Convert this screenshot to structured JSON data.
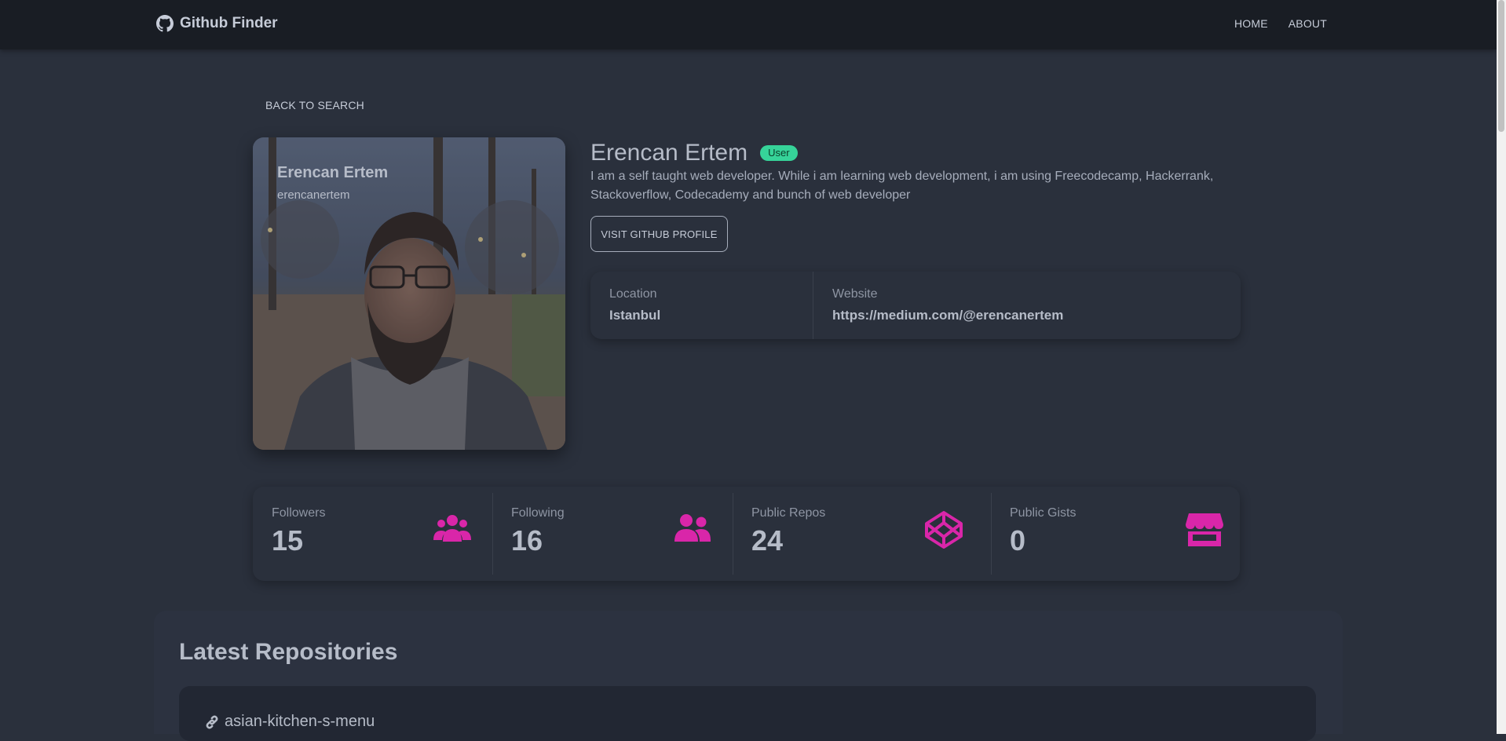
{
  "navbar": {
    "brand": "Github Finder",
    "brand_icon": "github-icon",
    "links": [
      "HOME",
      "ABOUT"
    ]
  },
  "back_label": "BACK TO SEARCH",
  "avatar": {
    "name": "Erencan Ertem",
    "login": "erencanertem"
  },
  "profile": {
    "name": "Erencan Ertem",
    "badge": "User",
    "bio": "I am a self taught web developer. While i am learning web development, i am using Freecodecamp, Hackerrank, Stackoverflow, Codecademy and bunch of web developer",
    "visit_label": "VISIT GITHUB PROFILE",
    "location_label": "Location",
    "location": "Istanbul",
    "website_label": "Website",
    "website": "https://medium.com/@erencanertem"
  },
  "stats": [
    {
      "label": "Followers",
      "value": "15",
      "icon": "users-icon"
    },
    {
      "label": "Following",
      "value": "16",
      "icon": "user-friends-icon"
    },
    {
      "label": "Public Repos",
      "value": "24",
      "icon": "codepen-icon"
    },
    {
      "label": "Public Gists",
      "value": "0",
      "icon": "store-icon"
    }
  ],
  "repos": {
    "title": "Latest Repositories",
    "items": [
      {
        "name": "asian-kitchen-s-menu",
        "icon": "link-icon"
      }
    ]
  },
  "colors": {
    "background": "#2a303c",
    "navbar": "#191d24",
    "accent_pink": "#d926a9",
    "badge_green": "#36d399"
  }
}
